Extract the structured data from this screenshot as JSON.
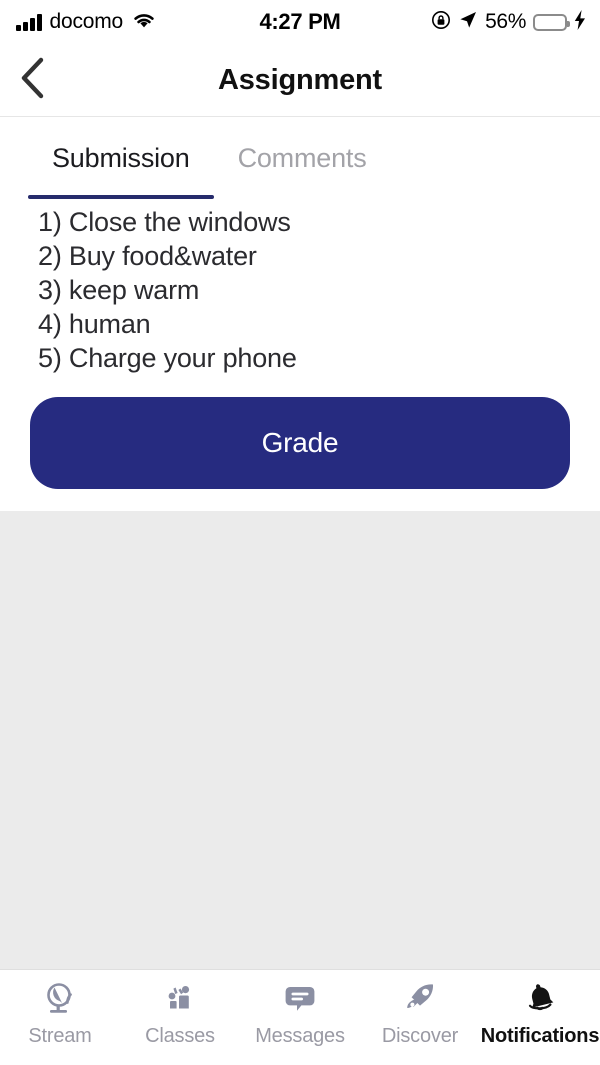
{
  "status_bar": {
    "carrier": "docomo",
    "time": "4:27 PM",
    "battery_percent": "56%",
    "battery_level": 56,
    "icons": [
      "signal-bars-icon",
      "wifi-icon",
      "rotation-lock-icon",
      "location-arrow-icon",
      "battery-icon",
      "charging-bolt-icon"
    ]
  },
  "nav": {
    "back_icon": "chevron-left-icon",
    "title": "Assignment"
  },
  "tabs": {
    "items": [
      {
        "label": "Submission",
        "active": true
      },
      {
        "label": "Comments",
        "active": false
      }
    ]
  },
  "submission": {
    "lines": [
      "1) Close the windows",
      "2) Buy food&water",
      "3) keep warm",
      "4) human",
      "5) Charge your phone"
    ],
    "grade_label": "Grade"
  },
  "tab_bar": {
    "items": [
      {
        "label": "Stream",
        "icon": "globe-icon",
        "active": false
      },
      {
        "label": "Classes",
        "icon": "students-icon",
        "active": false
      },
      {
        "label": "Messages",
        "icon": "chat-bubble-icon",
        "active": false
      },
      {
        "label": "Discover",
        "icon": "rocket-icon",
        "active": false
      },
      {
        "label": "Notifications",
        "icon": "bell-icon",
        "active": true
      }
    ]
  },
  "colors": {
    "accent_navy": "#262b80",
    "tab_underline": "#262b6c",
    "inactive_gray": "#9a9aa4",
    "battery_green": "#4cd964",
    "page_bg": "#ebebeb"
  }
}
